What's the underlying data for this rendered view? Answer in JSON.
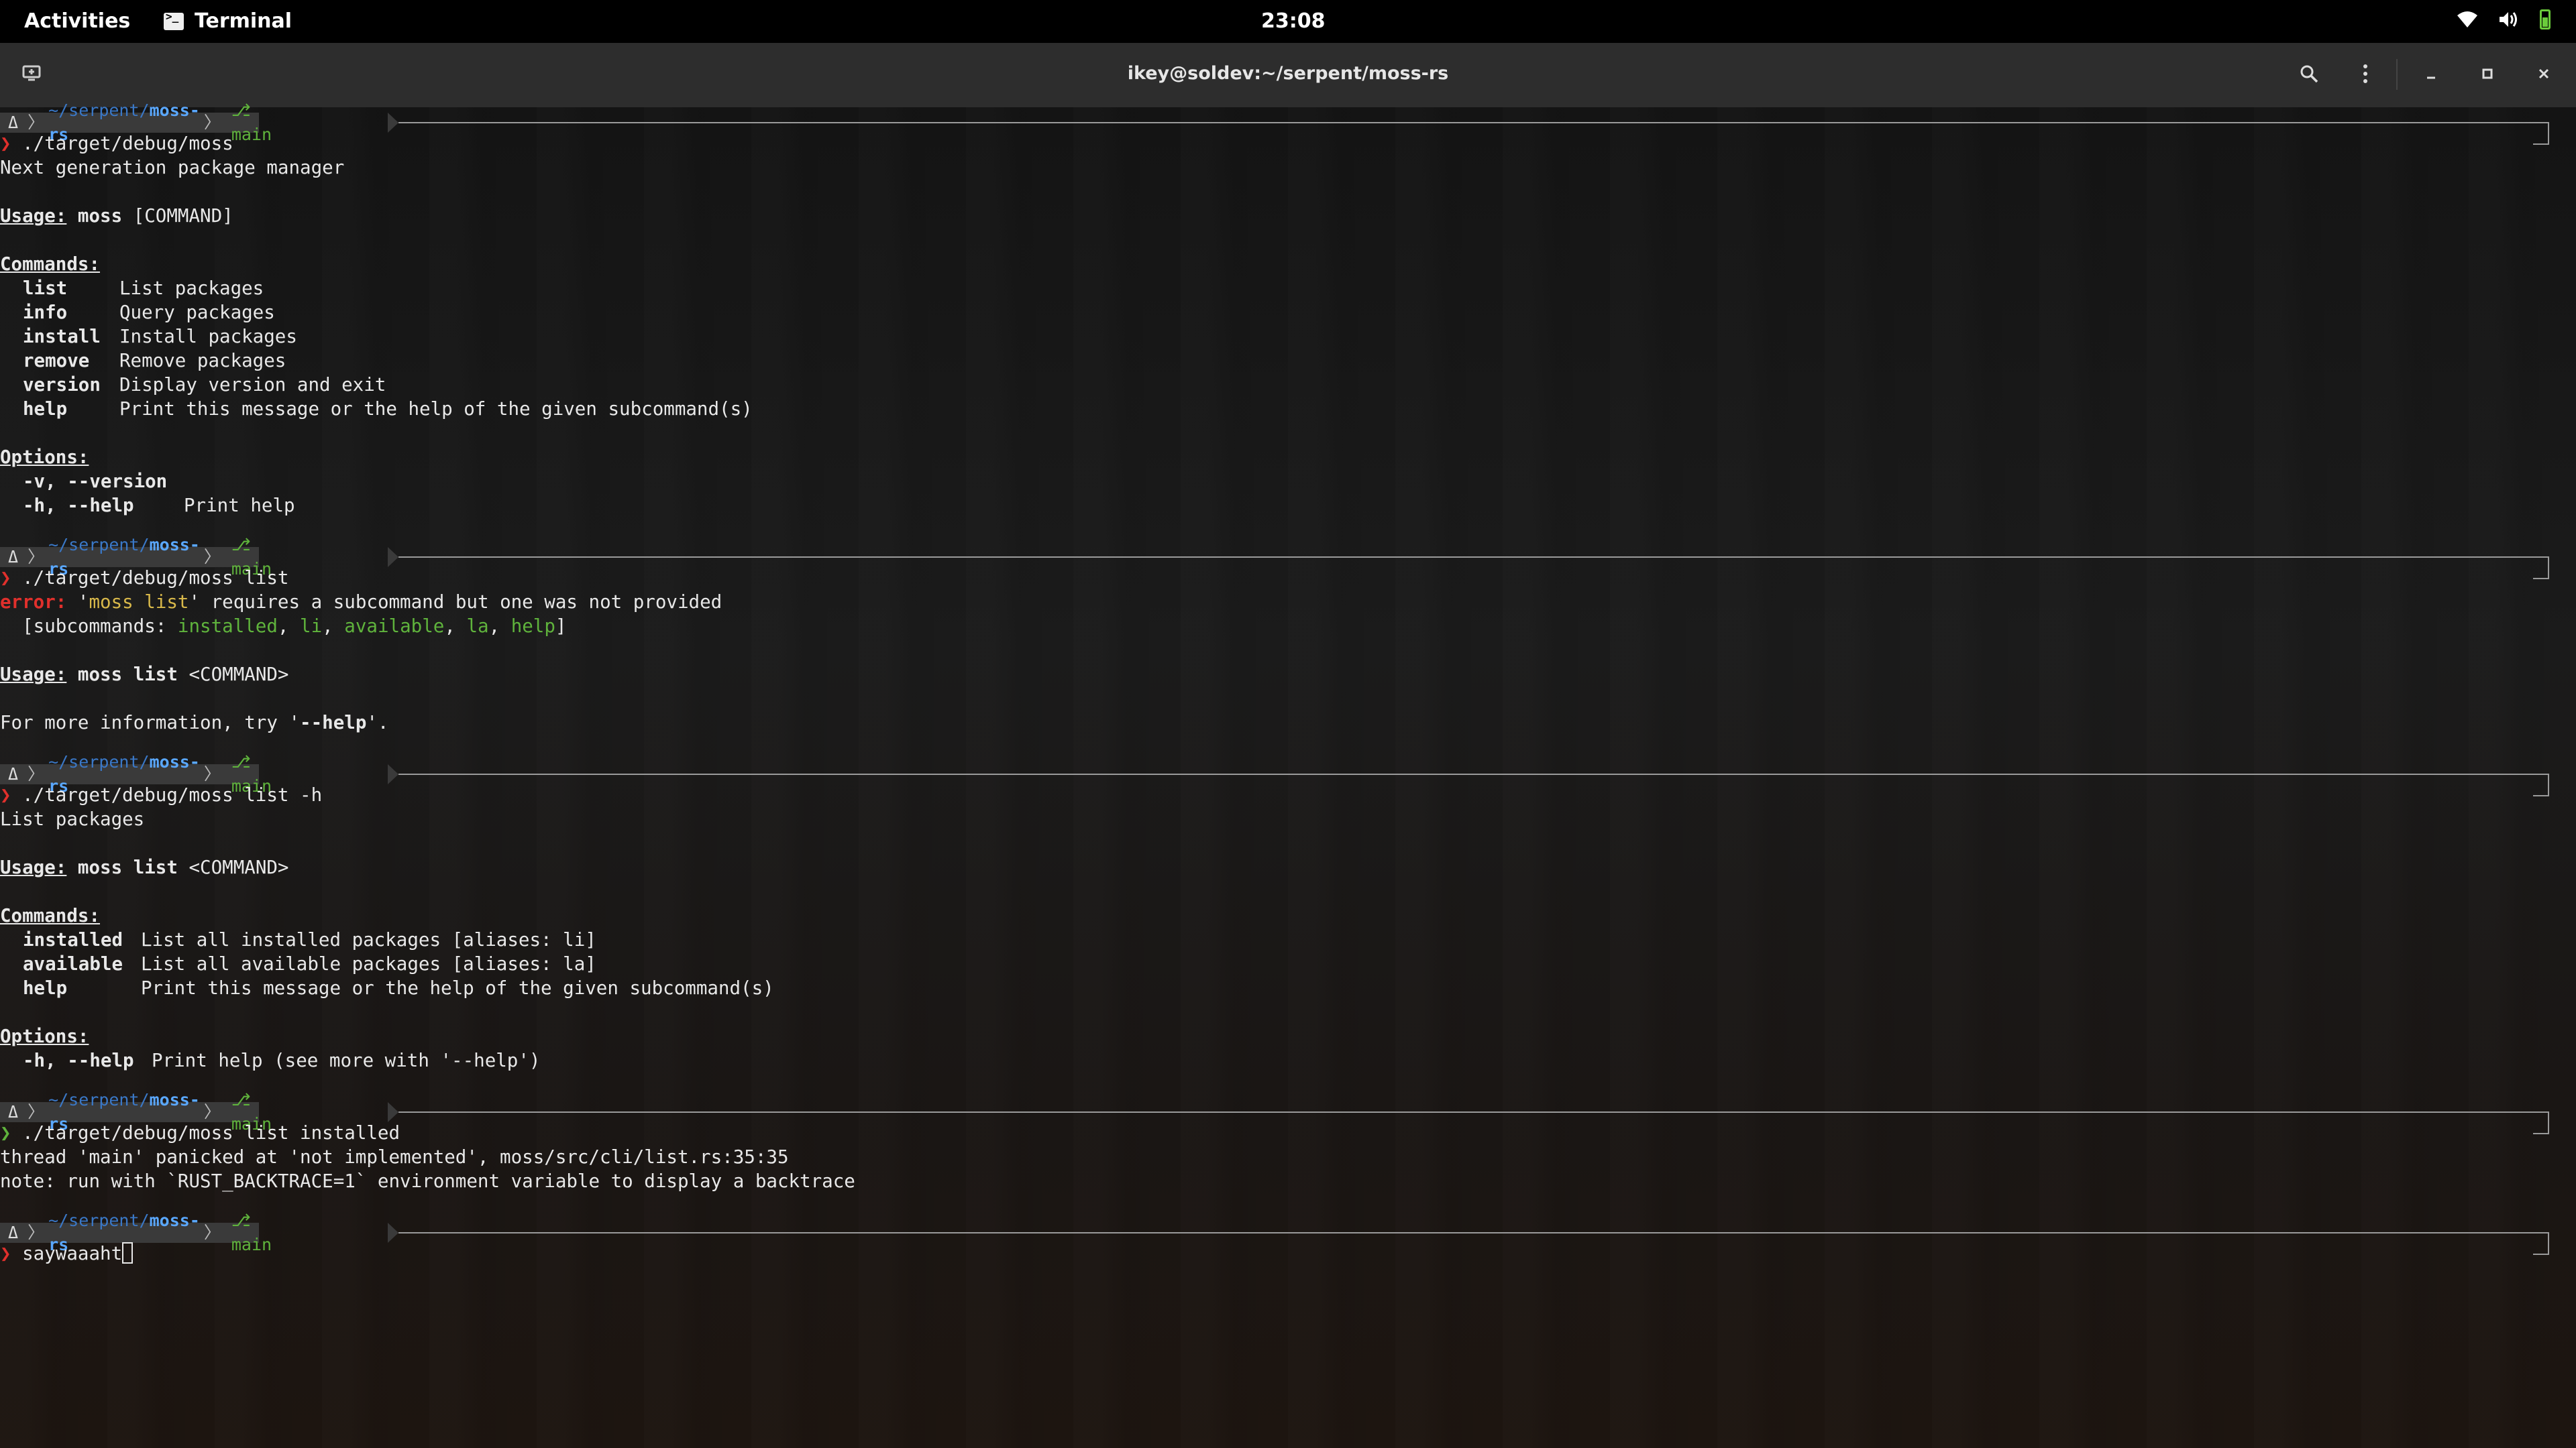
{
  "topbar": {
    "activities": "Activities",
    "app_name": "Terminal",
    "clock": "23:08",
    "icons": [
      "wifi-icon",
      "volume-icon",
      "battery-icon"
    ]
  },
  "window": {
    "title": "ikey@soldev:~/serpent/moss-rs",
    "buttons": [
      "new-tab-icon",
      "search-icon",
      "menu-icon",
      "minimize-icon",
      "maximize-icon",
      "close-icon"
    ]
  },
  "prompt": {
    "os": "Δ",
    "home": "~/serpent/",
    "repo": "moss-rs",
    "git_icon": "⎇",
    "branch": "main",
    "symbol": "❯"
  },
  "blocks": [
    {
      "command": "./target/debug/moss",
      "output": {
        "desc": "Next generation package manager",
        "usage_label": "Usage:",
        "usage_bin": "moss",
        "usage_args": " [COMMAND]",
        "commands_label": "Commands:",
        "commands": [
          {
            "name": "list",
            "desc": "List packages"
          },
          {
            "name": "info",
            "desc": "Query packages"
          },
          {
            "name": "install",
            "desc": "Install packages"
          },
          {
            "name": "remove",
            "desc": "Remove packages"
          },
          {
            "name": "version",
            "desc": "Display version and exit"
          },
          {
            "name": "help",
            "desc": "Print this message or the help of the given subcommand(s)"
          }
        ],
        "options_label": "Options:",
        "options": [
          {
            "flag": "-v, --version",
            "desc": ""
          },
          {
            "flag": "-h, --help",
            "desc": "Print help"
          }
        ]
      }
    },
    {
      "command": "./target/debug/moss list",
      "output": {
        "error_label": "error:",
        "error_q1": " '",
        "error_cmd": "moss list",
        "error_rest": "' requires a subcommand but one was not provided",
        "sub_open": "  [subcommands: ",
        "subcommands": [
          "installed",
          "li",
          "available",
          "la",
          "help"
        ],
        "sub_close": "]",
        "usage_label": "Usage:",
        "usage_bin": "moss list",
        "usage_args": " <COMMAND>",
        "more_pre": "For more information, try '",
        "more_flag": "--help",
        "more_post": "'."
      }
    },
    {
      "command": "./target/debug/moss list -h",
      "output": {
        "desc": "List packages",
        "usage_label": "Usage:",
        "usage_bin": "moss list",
        "usage_args": " <COMMAND>",
        "commands_label": "Commands:",
        "commands": [
          {
            "name": "installed",
            "desc": "List all installed packages [aliases: li]"
          },
          {
            "name": "available",
            "desc": "List all available packages [aliases: la]"
          },
          {
            "name": "help",
            "desc": "Print this message or the help of the given subcommand(s)"
          }
        ],
        "options_label": "Options:",
        "options": [
          {
            "flag": "-h, --help",
            "desc": "Print help (see more with '--help')"
          }
        ]
      }
    },
    {
      "command": "./target/debug/moss list installed",
      "output": {
        "lines": [
          "thread 'main' panicked at 'not implemented', moss/src/cli/list.rs:35:35",
          "note: run with `RUST_BACKTRACE=1` environment variable to display a backtrace"
        ]
      }
    },
    {
      "command": "saywaaaht"
    }
  ]
}
